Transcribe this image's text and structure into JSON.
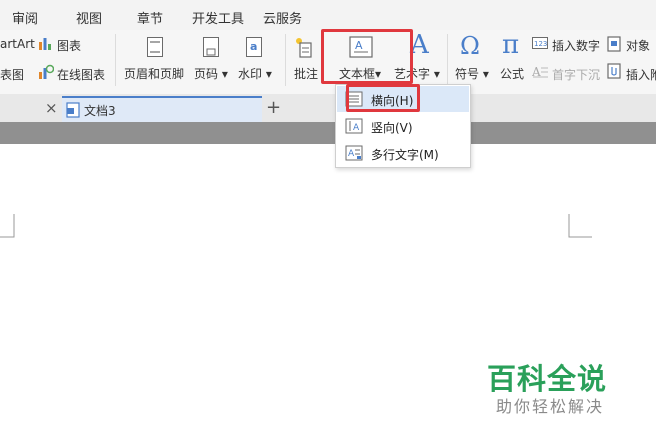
{
  "menu": [
    "审阅",
    "视图",
    "章节",
    "开发工具",
    "云服务"
  ],
  "ribbon": {
    "smartart": "artArt",
    "chart": "图表",
    "screenshot": "表图",
    "online_chart": "在线图表",
    "header_footer": "页眉和页脚",
    "page_number": "页码",
    "watermark": "水印",
    "comment": "批注",
    "textbox": "文本框",
    "wordart": "艺术字",
    "symbol": "符号",
    "formula": "公式",
    "insert_number": "插入数字",
    "object": "对象",
    "drop_cap": "首字下沉",
    "insert_attachment": "插入附",
    "dropdown_arrow": "▾"
  },
  "tabs": {
    "doc_title": "文档3",
    "close_glyph": "×",
    "new_tab_glyph": "+"
  },
  "textbox_menu": [
    {
      "label": "横向(H)"
    },
    {
      "label": "竖向(V)"
    },
    {
      "label": "多行文字(M)"
    }
  ],
  "watermark": {
    "title": "百科全说",
    "subtitle": "助你轻松解决"
  },
  "colors": {
    "highlight": "#e0383e",
    "accent_blue": "#4a7ec9",
    "watermark_green": "#2aa05a"
  }
}
